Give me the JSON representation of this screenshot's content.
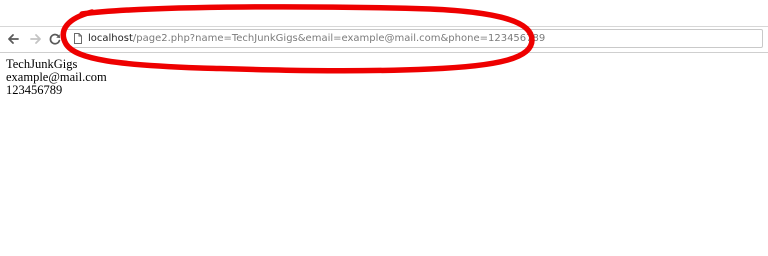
{
  "browser": {
    "address_bar": {
      "host": "localhost",
      "path": "/page2.php?name=TechJunkGigs&email=example@mail.com&phone=123456789"
    },
    "icons": {
      "back": "back-arrow-icon",
      "forward": "forward-arrow-icon",
      "reload": "reload-icon",
      "page": "page-icon"
    }
  },
  "annotation": {
    "color": "#ee0000",
    "shape": "hand-drawn ellipse around address bar"
  },
  "page": {
    "lines": [
      "TechJunkGigs",
      "example@mail.com",
      "123456789"
    ]
  }
}
